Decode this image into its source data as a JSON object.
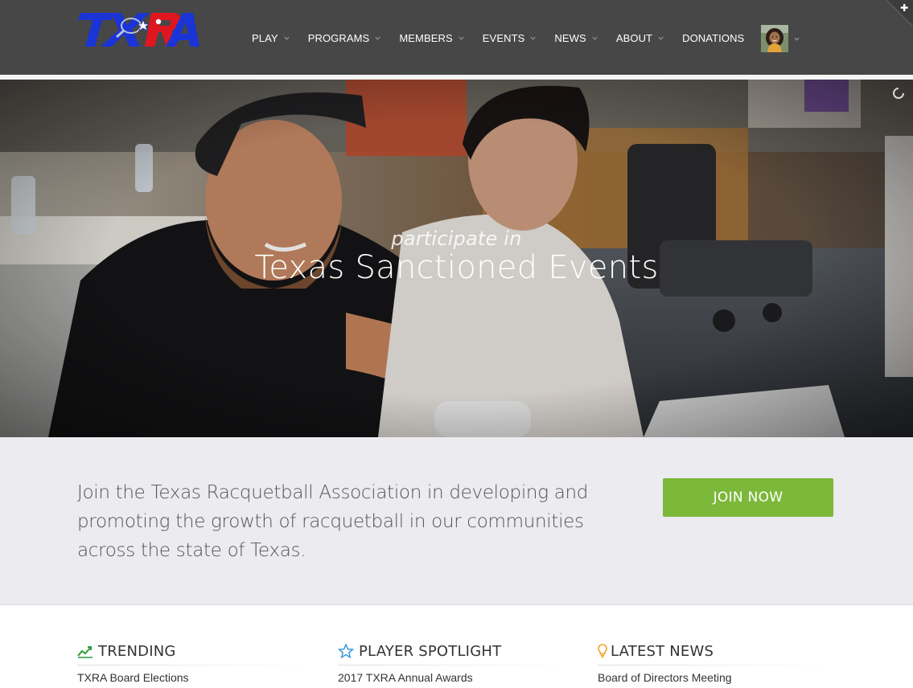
{
  "brand": {
    "logo_text": "TXRA",
    "colors": {
      "blue": "#1a34d6",
      "red": "#e0161f",
      "header_bg": "#474747",
      "accent_green": "#7cb83a"
    }
  },
  "nav": {
    "items": [
      {
        "label": "PLAY",
        "has_dropdown": true
      },
      {
        "label": "PROGRAMS",
        "has_dropdown": true
      },
      {
        "label": "MEMBERS",
        "has_dropdown": true
      },
      {
        "label": "EVENTS",
        "has_dropdown": true
      },
      {
        "label": "NEWS",
        "has_dropdown": true
      },
      {
        "label": "ABOUT",
        "has_dropdown": true
      },
      {
        "label": "DONATIONS",
        "has_dropdown": false
      }
    ],
    "user_menu_icon": "avatar",
    "corner_icon": "plus-icon"
  },
  "hero": {
    "kicker": "participate in",
    "title": "Texas Sanctioned Events",
    "loader_icon": "spinner-icon"
  },
  "join": {
    "text": "Join the Texas Racquetball Association in developing and promoting the growth of racquetball in our communities across the state of Texas.",
    "button_label": "JOIN NOW"
  },
  "columns": [
    {
      "icon": "line-chart-icon",
      "title": "TRENDING",
      "link": "TXRA Board Elections",
      "icon_color": "#2f9a3c"
    },
    {
      "icon": "star-icon",
      "title": "PLAYER SPOTLIGHT",
      "link": "2017 TXRA Annual Awards",
      "icon_color": "#3a9bd9"
    },
    {
      "icon": "lightbulb-icon",
      "title": "LATEST NEWS",
      "link": "Board of Directors Meeting",
      "icon_color": "#f0a020"
    }
  ]
}
